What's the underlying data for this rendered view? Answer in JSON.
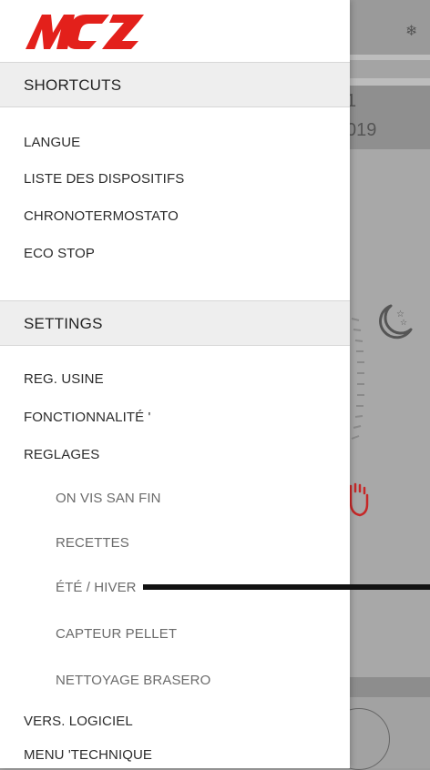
{
  "background": {
    "snow_icon": "❄",
    "date_line1": "1",
    "date_line2": "019"
  },
  "drawer": {
    "logo_text": "MCZ",
    "shortcuts": {
      "header": "SHORTCUTS",
      "items": [
        {
          "label": "LANGUE"
        },
        {
          "label": "LISTE DES DISPOSITIFS"
        },
        {
          "label": "CHRONOTERMOSTATO"
        },
        {
          "label": "ECO STOP"
        }
      ]
    },
    "settings": {
      "header": "SETTINGS",
      "items": [
        {
          "label": "REG. USINE"
        },
        {
          "label": "FONCTIONNALITÉ '"
        },
        {
          "label": "REGLAGES"
        }
      ],
      "subitems": [
        {
          "label": "ON VIS SAN FIN"
        },
        {
          "label": "RECETTES"
        },
        {
          "label": "ÉTÉ / HIVER"
        },
        {
          "label": "CAPTEUR PELLET"
        },
        {
          "label": "NETTOYAGE BRASERO"
        }
      ],
      "more_items": [
        {
          "label": "VERS. LOGICIEL"
        },
        {
          "label": "MENU 'TECHNIQUE"
        }
      ]
    }
  },
  "colors": {
    "logo_red": "#e3201b",
    "accent_red": "#c62828"
  }
}
